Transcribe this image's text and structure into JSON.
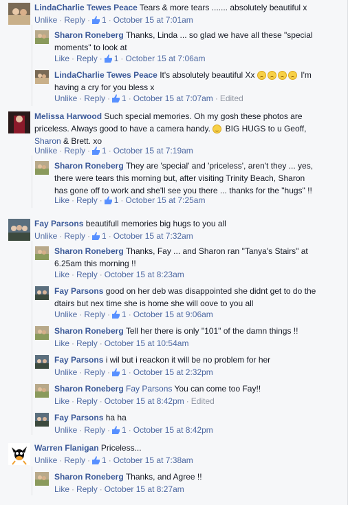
{
  "comments": [
    {
      "name": "LindaCharlie Tewes Peace",
      "text": "Tears & more tears ....... absolutely beautiful x",
      "actions": [
        "Unlike",
        "Reply"
      ],
      "likes": "1",
      "time": "October 15 at 7:01am"
    },
    {
      "name": "Sharon Roneberg",
      "text": "Thanks, Linda ... so glad we have all these \"special",
      "text2": "moments\" to look at",
      "actions": [
        "Like",
        "Reply"
      ],
      "likes": "1",
      "time": "October 15 at 7:06am"
    },
    {
      "name": "LindaCharlie Tewes Peace",
      "text": "It's absolutely beautiful Xx",
      "text_after": "I'm",
      "text2": "having a cry for you bless x",
      "actions": [
        "Unlike",
        "Reply"
      ],
      "likes": "1",
      "time": "October 15 at 7:07am",
      "edited": "Edited"
    },
    {
      "name": "Melissa Harwood",
      "text": "Such special memories. Oh my gosh these photos are",
      "text2": "priceless. Always good to have a camera handy.",
      "text2b": "BIG HUGS to u Geoff,",
      "tag": "Sharon",
      "text3": "& Brett. xo",
      "actions": [
        "Unlike",
        "Reply"
      ],
      "likes": "1",
      "time": "October 15 at 7:19am"
    },
    {
      "name": "Sharon Roneberg",
      "text": "They are 'special' and 'priceless', aren't they ... yes,",
      "text2": "there were tears this morning but, after visiting Trinity Beach, Sharon",
      "text3": "has gone off to work and she'll see you there ... thanks for the \"hugs\" !!",
      "actions": [
        "Like",
        "Reply"
      ],
      "likes": "1",
      "time": "October 15 at 7:25am"
    },
    {
      "name": "Fay Parsons",
      "text": "beautifull memories big hugs to you all",
      "actions": [
        "Unlike",
        "Reply"
      ],
      "likes": "1",
      "time": "October 15 at 7:32am"
    },
    {
      "name": "Sharon Roneberg",
      "text": "Thanks, Fay ... and Sharon ran \"Tanya's Stairs\" at",
      "text2": "6.25am this morning !!",
      "actions": [
        "Like",
        "Reply"
      ],
      "time": "October 15 at 8:23am"
    },
    {
      "name": "Fay Parsons",
      "text": "good on her deb was disappointed she didnt get to do the",
      "text2": "dtairs but nex time she is home she will oove to you all",
      "actions": [
        "Unlike",
        "Reply"
      ],
      "likes": "1",
      "time": "October 15 at 9:06am"
    },
    {
      "name": "Sharon Roneberg",
      "text": "Tell her there is only \"101\" of the damn things !!",
      "actions": [
        "Like",
        "Reply"
      ],
      "time": "October 15 at 10:54am"
    },
    {
      "name": "Fay Parsons",
      "text": "i wil but i reackon it will be no problem for her",
      "actions": [
        "Unlike",
        "Reply"
      ],
      "likes": "1",
      "time": "October 15 at 2:32pm"
    },
    {
      "name": "Sharon Roneberg",
      "tag": "Fay Parsons",
      "text": "You can come too Fay!!",
      "actions": [
        "Like",
        "Reply"
      ],
      "time": "October 15 at 8:42pm",
      "edited": "Edited"
    },
    {
      "name": "Fay Parsons",
      "text": "ha ha",
      "actions": [
        "Unlike",
        "Reply"
      ],
      "likes": "1",
      "time": "October 15 at 8:42pm"
    },
    {
      "name": "Warren Flanigan",
      "text": "Priceless...",
      "actions": [
        "Unlike",
        "Reply"
      ],
      "likes": "1",
      "time": "October 15 at 7:38am"
    },
    {
      "name": "Sharon Roneberg",
      "text": "Thanks, and Agree !!",
      "actions": [
        "Like",
        "Reply"
      ],
      "time": "October 15 at 8:27am"
    }
  ],
  "colors": {
    "link": "#3b5998",
    "meta": "#9197a3",
    "text": "#141823",
    "background": "#f6f7f9"
  }
}
